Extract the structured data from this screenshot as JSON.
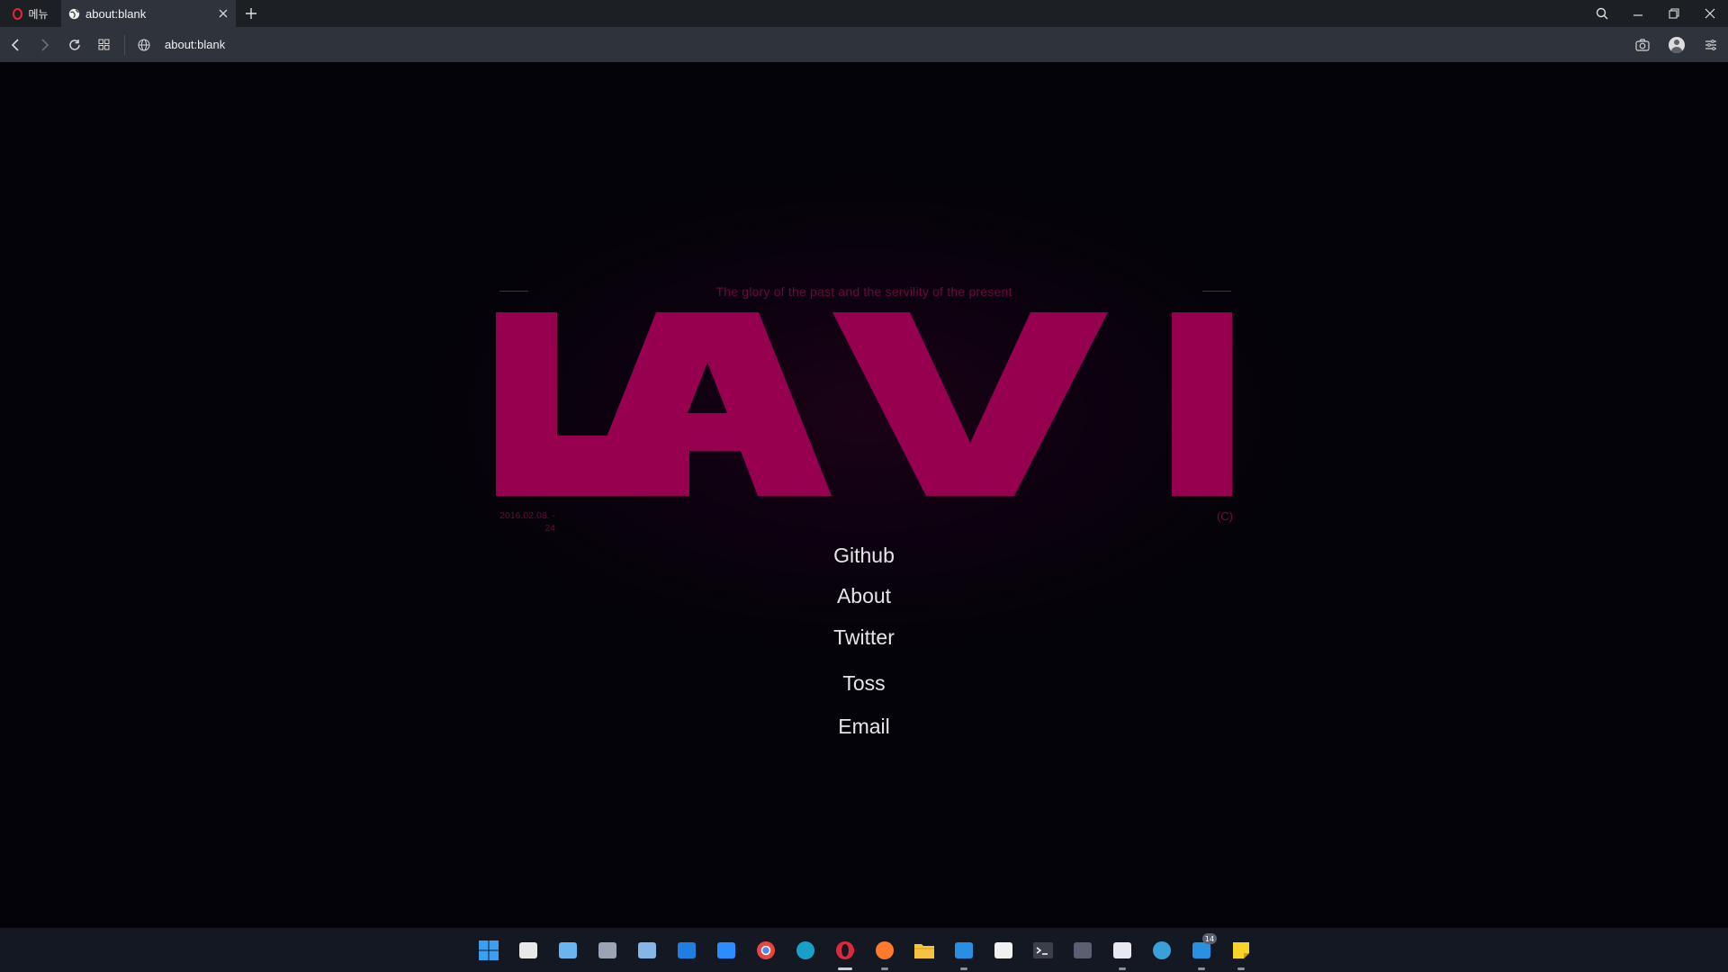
{
  "browser": {
    "menu_label": "메뉴",
    "tab_title": "about:blank",
    "url": "about:blank"
  },
  "page": {
    "tagline": "The glory of the past and the servility of the present",
    "logo_text": "LAVI",
    "date_line1": "2016.02.08. -",
    "date_line2": "24",
    "copyright": "(C)",
    "links": [
      "Github",
      "About",
      "Twitter",
      "Toss",
      "Email"
    ],
    "colors": {
      "brand": "#96004f",
      "background": "#04030a",
      "link_text": "#e6e6ea"
    }
  },
  "taskbar": {
    "icons": [
      {
        "name": "start-icon",
        "color": "#3a9ff0"
      },
      {
        "name": "store-icon",
        "color": "#e8e8e8"
      },
      {
        "name": "photos-icon",
        "color": "#6cb4f0"
      },
      {
        "name": "settings-icon",
        "color": "#9aa4b4"
      },
      {
        "name": "image-viewer-icon",
        "color": "#86b6e6"
      },
      {
        "name": "mail-icon",
        "color": "#1e7fe0"
      },
      {
        "name": "zoom-icon",
        "color": "#2d8cff"
      },
      {
        "name": "chrome-icon",
        "color": "#e8453c"
      },
      {
        "name": "edge-icon",
        "color": "#1aa0c8"
      },
      {
        "name": "opera-icon",
        "color": "#e0283c"
      },
      {
        "name": "firefox-icon",
        "color": "#ff7a2a"
      },
      {
        "name": "file-explorer-icon",
        "color": "#f5c242"
      },
      {
        "name": "vscode-icon",
        "color": "#2a8fe0"
      },
      {
        "name": "notion-icon",
        "color": "#f0f0f0"
      },
      {
        "name": "terminal-icon",
        "color": "#3a3f4a"
      },
      {
        "name": "calculator-icon",
        "color": "#5a6072"
      },
      {
        "name": "snipping-tool-icon",
        "color": "#e8e8f0"
      },
      {
        "name": "network-icon",
        "color": "#3aa0d8"
      },
      {
        "name": "remote-desktop-icon",
        "color": "#2a90e0"
      },
      {
        "name": "sticky-notes-icon",
        "color": "#f8d428"
      }
    ],
    "badge_count": "14"
  }
}
